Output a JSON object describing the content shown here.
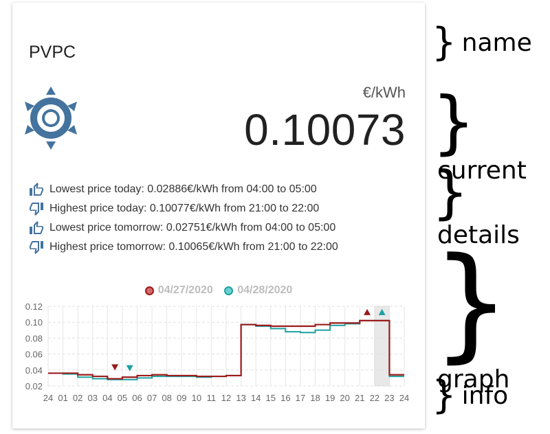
{
  "card": {
    "name": "PVPC",
    "unit": "€/kWh",
    "current_value": "0.10073",
    "icon": "sun-icon",
    "details": [
      {
        "icon": "thumb-up-icon",
        "text": "Lowest price today: 0.02886€/kWh from 04:00 to 05:00"
      },
      {
        "icon": "thumb-down-icon",
        "text": "Highest price today: 0.10077€/kWh from 21:00 to 22:00"
      },
      {
        "icon": "thumb-up-icon",
        "text": "Lowest price tomorrow: 0.02751€/kWh from 04:00 to 05:00"
      },
      {
        "icon": "thumb-down-icon",
        "text": "Highest price tomorrow: 0.10065€/kWh from 21:00 to 22:00"
      }
    ],
    "accent_color": "#44739e"
  },
  "annotations": {
    "name": "name",
    "current": "current",
    "details": "details",
    "graph": "graph",
    "info": "info"
  },
  "chart_data": {
    "type": "line",
    "series": [
      {
        "name": "04/27/2020",
        "color": "#9b1b1b",
        "values": [
          0.036,
          0.036,
          0.034,
          0.032,
          0.029,
          0.031,
          0.033,
          0.034,
          0.033,
          0.033,
          0.032,
          0.032,
          0.033,
          0.097,
          0.096,
          0.095,
          0.095,
          0.095,
          0.097,
          0.099,
          0.099,
          0.102,
          0.102,
          0.034
        ]
      },
      {
        "name": "04/28/2020",
        "color": "#1ea0a0",
        "values": [
          0.036,
          0.035,
          0.031,
          0.029,
          0.028,
          0.028,
          0.03,
          0.032,
          0.032,
          0.032,
          0.031,
          0.032,
          0.033,
          0.097,
          0.095,
          0.092,
          0.088,
          0.087,
          0.09,
          0.096,
          0.098,
          0.102,
          0.102,
          0.032
        ]
      }
    ],
    "xlabels": [
      "24",
      "01",
      "02",
      "03",
      "04",
      "05",
      "06",
      "07",
      "08",
      "09",
      "10",
      "11",
      "12",
      "13",
      "14",
      "15",
      "16",
      "17",
      "18",
      "19",
      "20",
      "21",
      "22",
      "23",
      "24"
    ],
    "yticks": [
      "0.12",
      "0.10",
      "0.08",
      "0.06",
      "0.04",
      "0.02"
    ],
    "ylim": [
      0.02,
      0.12
    ],
    "current_hour": 22,
    "min_markers": [
      {
        "series": 0,
        "hour": 4
      },
      {
        "series": 1,
        "hour": 5
      }
    ],
    "max_markers": [
      {
        "series": 0,
        "hour": 21
      },
      {
        "series": 1,
        "hour": 22
      }
    ],
    "grid": true
  }
}
